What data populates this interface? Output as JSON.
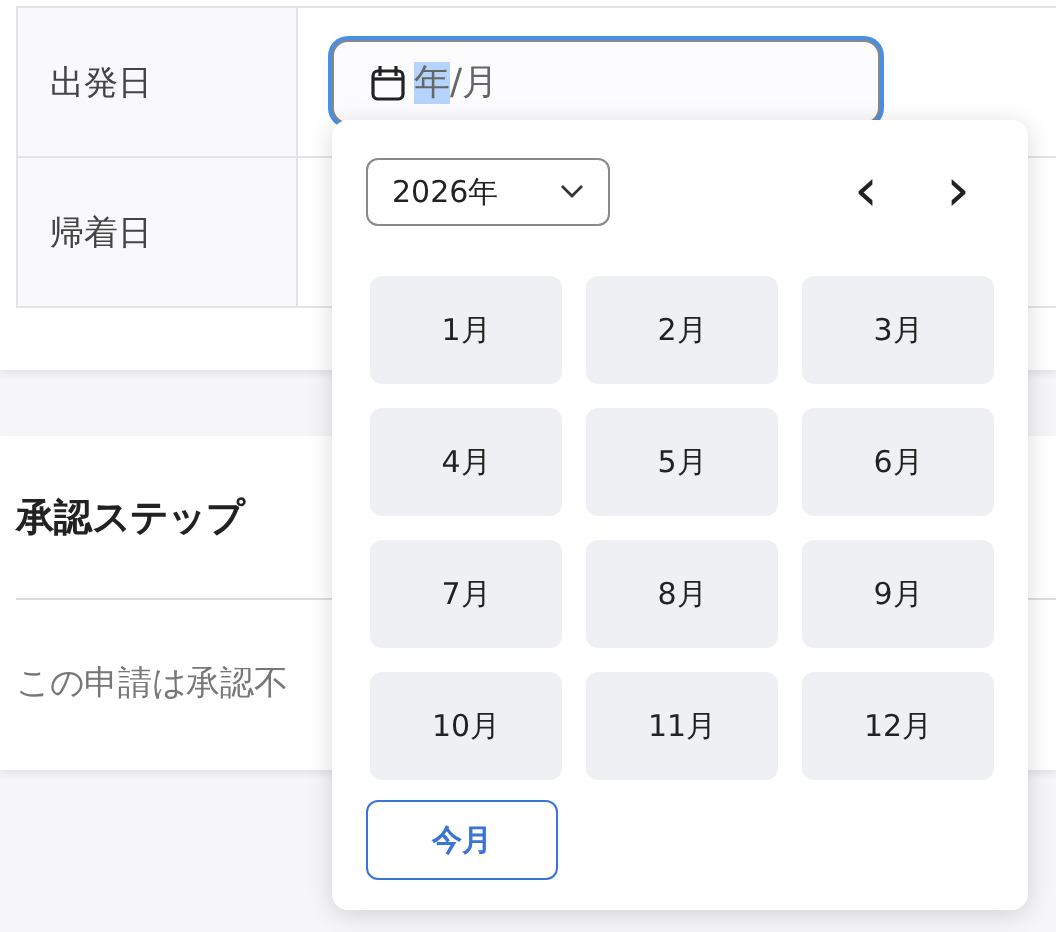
{
  "form_rows": [
    {
      "label": "出発日",
      "field": {
        "segments": [
          {
            "text": "年",
            "selected": true
          },
          {
            "text": "月",
            "selected": false
          }
        ],
        "separator": "/",
        "focused": true
      }
    },
    {
      "label": "帰着日"
    }
  ],
  "approval": {
    "title": "承認ステップ",
    "message": "この申請は承認不"
  },
  "month_picker": {
    "year": "2026年",
    "prev": "‹",
    "next": "›",
    "months": [
      {
        "label": "1月"
      },
      {
        "label": "2月"
      },
      {
        "label": "3月"
      },
      {
        "label": "4月"
      },
      {
        "label": "5月"
      },
      {
        "label": "6月"
      },
      {
        "label": "7月"
      },
      {
        "label": "8月"
      },
      {
        "label": "9月"
      },
      {
        "label": "10月"
      },
      {
        "label": "11月"
      },
      {
        "label": "12月"
      }
    ],
    "today_button": "今月"
  }
}
